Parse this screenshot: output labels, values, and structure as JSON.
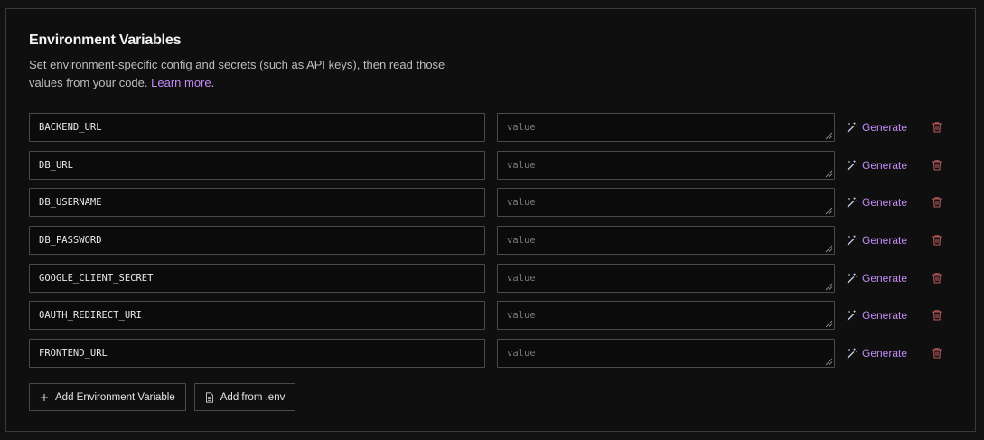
{
  "section": {
    "title": "Environment Variables",
    "description": "Set environment-specific config and secrets (such as API keys), then read those values from your code.",
    "learn_more": "Learn more",
    "trailing_period": "."
  },
  "value_placeholder": "value",
  "generate_label": "Generate",
  "variables": [
    {
      "key": "BACKEND_URL",
      "value": ""
    },
    {
      "key": "DB_URL",
      "value": ""
    },
    {
      "key": "DB_USERNAME",
      "value": ""
    },
    {
      "key": "DB_PASSWORD",
      "value": ""
    },
    {
      "key": "GOOGLE_CLIENT_SECRET",
      "value": ""
    },
    {
      "key": "OAUTH_REDIRECT_URI",
      "value": ""
    },
    {
      "key": "FRONTEND_URL",
      "value": ""
    }
  ],
  "actions": {
    "add_variable_label": "Add Environment Variable",
    "add_from_env_label": "Add from .env"
  },
  "icons": {
    "generate": "magic-wand-icon",
    "delete": "trash-icon",
    "add": "plus-icon",
    "file": "file-icon"
  },
  "colors": {
    "accent": "#c28bf5",
    "delete": "#b45a5a",
    "border": "#4a4a4a",
    "background": "#0f0f0f"
  }
}
